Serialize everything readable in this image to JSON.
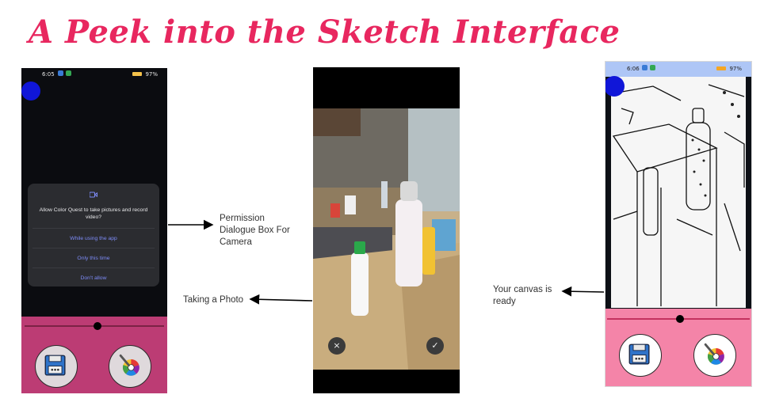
{
  "title": "A Peek into the Sketch Interface",
  "phone1": {
    "status_time": "6:05",
    "status_right": "97%",
    "dialog": {
      "message": "Allow Color Quest to take pictures and record video?",
      "options": [
        "While using the app",
        "Only this time",
        "Don't allow"
      ]
    },
    "slider_level": 0.52,
    "buttons": [
      "floppy-disk-icon",
      "color-wheel-icon"
    ]
  },
  "phone2": {
    "cancel_glyph": "×",
    "confirm_glyph": "✓"
  },
  "phone3": {
    "status_time": "6:06",
    "status_right": "97%",
    "slider_level": 0.51
  },
  "labels": {
    "permission": "Permission Dialogue Box For Camera",
    "taking_photo": "Taking a Photo",
    "canvas_ready": "Your canvas is ready"
  },
  "colors": {
    "title": "#e8275f",
    "dialog_option": "#7e8cf8",
    "pink_dark": "#bc3c74",
    "pink_light": "#f484a8"
  }
}
